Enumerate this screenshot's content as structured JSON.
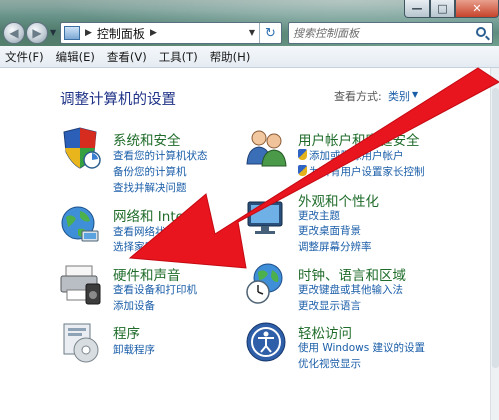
{
  "window": {
    "minimize_glyph": "—",
    "maximize_glyph": "□",
    "close_glyph": "✕"
  },
  "navigation": {
    "back_glyph": "◀",
    "forward_glyph": "▶",
    "dropdown_glyph": "▼"
  },
  "address_bar": {
    "icon": "control-panel-icon",
    "separator": "▶",
    "breadcrumb": "控制面板",
    "breadcrumb_arrow": "▶",
    "dropdown_glyph": "▼",
    "refresh_glyph": "↻"
  },
  "search": {
    "placeholder": "搜索控制面板",
    "icon": "search-icon"
  },
  "menu": {
    "items": [
      "文件(F)",
      "编辑(E)",
      "查看(V)",
      "工具(T)",
      "帮助(H)"
    ]
  },
  "page": {
    "title": "调整计算机的设置",
    "view_by_label": "查看方式:",
    "view_by_value": "类别",
    "view_by_arrow": "▼"
  },
  "categories": [
    {
      "title": "系统和安全",
      "icon": "system-security-icon",
      "links": [
        "查看您的计算机状态",
        "备份您的计算机",
        "查找并解决问题"
      ]
    },
    {
      "title": "用户帐户和家庭安全",
      "icon": "user-accounts-icon",
      "links": [
        "添加或删除用户帐户",
        "为所有用户设置家长控制"
      ]
    },
    {
      "title": "网络和 Internet",
      "icon": "network-internet-icon",
      "links": [
        "查看网络状态和任务",
        "选择家庭组和共享选项"
      ]
    },
    {
      "title": "外观和个性化",
      "icon": "appearance-icon",
      "links": [
        "更改主题",
        "更改桌面背景",
        "调整屏幕分辨率"
      ]
    },
    {
      "title": "硬件和声音",
      "icon": "hardware-sound-icon",
      "links": [
        "查看设备和打印机",
        "添加设备"
      ]
    },
    {
      "title": "时钟、语言和区域",
      "icon": "clock-language-region-icon",
      "links": [
        "更改键盘或其他输入法",
        "更改显示语言"
      ]
    },
    {
      "title": "程序",
      "icon": "programs-icon",
      "links": [
        "卸载程序"
      ]
    },
    {
      "title": "轻松访问",
      "icon": "ease-of-access-icon",
      "links": [
        "使用 Windows 建议的设置",
        "优化视觉显示"
      ]
    }
  ],
  "colors": {
    "category_title": "#1f6c2a",
    "link": "#1b5ea8",
    "page_title": "#1e3287",
    "annotation_arrow": "#e8141e"
  }
}
